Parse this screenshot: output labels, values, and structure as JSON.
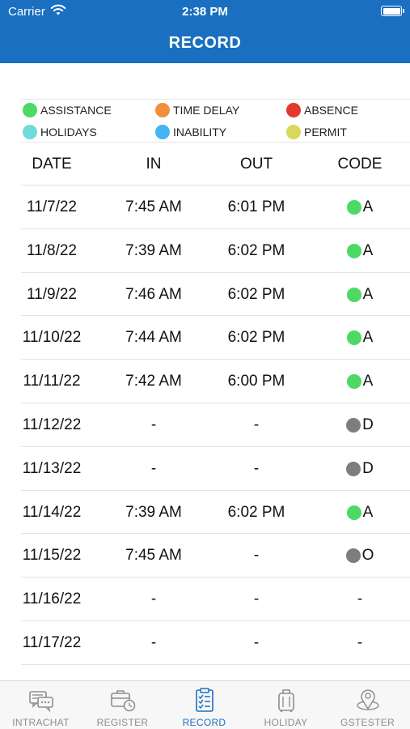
{
  "status_bar": {
    "carrier": "Carrier",
    "time": "2:38 PM"
  },
  "header": {
    "title": "RECORD"
  },
  "legend": [
    {
      "label": "ASSISTANCE",
      "color": "#4cd964"
    },
    {
      "label": "TIME DELAY",
      "color": "#f0913a"
    },
    {
      "label": "ABSENCE",
      "color": "#e2382f"
    },
    {
      "label": "HOLIDAYS",
      "color": "#6edbdb"
    },
    {
      "label": "INABILITY",
      "color": "#45b4f3"
    },
    {
      "label": "PERMIT",
      "color": "#d8d85a"
    }
  ],
  "table": {
    "headers": {
      "date": "DATE",
      "in": "IN",
      "out": "OUT",
      "code": "CODE"
    },
    "rows": [
      {
        "date": "11/7/22",
        "in": "7:45 AM",
        "out": "6:01 PM",
        "code": "A",
        "code_color": "#4cd964"
      },
      {
        "date": "11/8/22",
        "in": "7:39 AM",
        "out": "6:02 PM",
        "code": "A",
        "code_color": "#4cd964"
      },
      {
        "date": "11/9/22",
        "in": "7:46 AM",
        "out": "6:02 PM",
        "code": "A",
        "code_color": "#4cd964"
      },
      {
        "date": "11/10/22",
        "in": "7:44 AM",
        "out": "6:02 PM",
        "code": "A",
        "code_color": "#4cd964"
      },
      {
        "date": "11/11/22",
        "in": "7:42 AM",
        "out": "6:00 PM",
        "code": "A",
        "code_color": "#4cd964"
      },
      {
        "date": "11/12/22",
        "in": "-",
        "out": "-",
        "code": "D",
        "code_color": "#7d7d7d"
      },
      {
        "date": "11/13/22",
        "in": "-",
        "out": "-",
        "code": "D",
        "code_color": "#7d7d7d"
      },
      {
        "date": "11/14/22",
        "in": "7:39 AM",
        "out": "6:02 PM",
        "code": "A",
        "code_color": "#4cd964"
      },
      {
        "date": "11/15/22",
        "in": "7:45 AM",
        "out": "-",
        "code": "O",
        "code_color": "#7d7d7d"
      },
      {
        "date": "11/16/22",
        "in": "-",
        "out": "-",
        "code": "-",
        "code_color": ""
      },
      {
        "date": "11/17/22",
        "in": "-",
        "out": "-",
        "code": "-",
        "code_color": ""
      }
    ]
  },
  "tab_bar": {
    "tabs": [
      {
        "label": "INTRACHAT",
        "icon": "chat-icon",
        "active": false
      },
      {
        "label": "REGISTER",
        "icon": "briefcase-clock-icon",
        "active": false
      },
      {
        "label": "RECORD",
        "icon": "clipboard-check-icon",
        "active": true
      },
      {
        "label": "HOLIDAY",
        "icon": "suitcase-icon",
        "active": false
      },
      {
        "label": "GSTESTER",
        "icon": "gps-icon",
        "active": false
      }
    ]
  },
  "colors": {
    "primary": "#1a6fc0",
    "tab_inactive": "#8e8e8e"
  }
}
